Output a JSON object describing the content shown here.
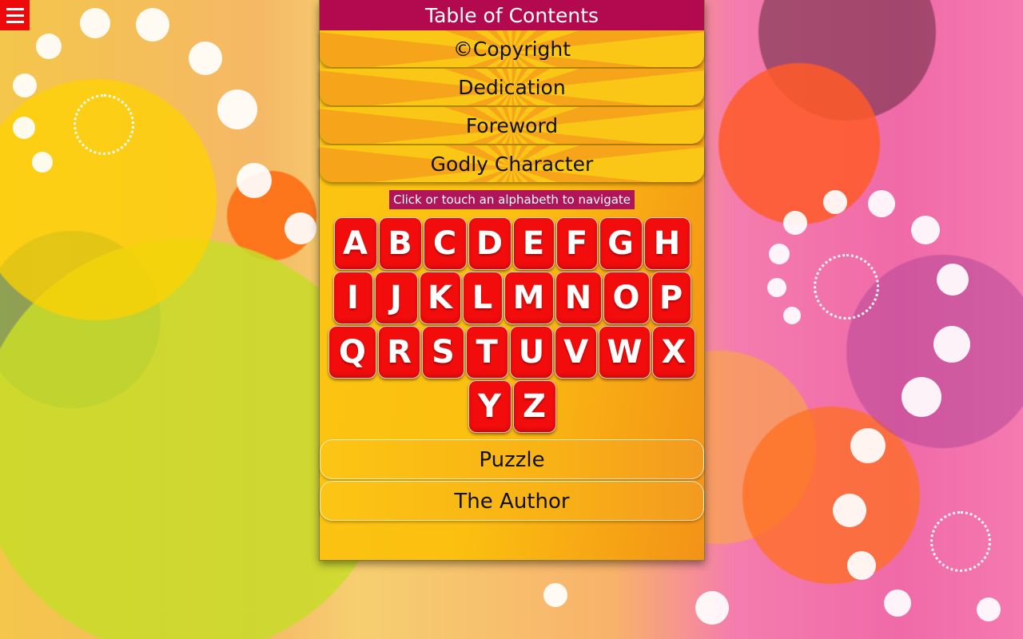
{
  "panel": {
    "title": "Table of Contents",
    "top_items": [
      {
        "label": "©Copyright"
      },
      {
        "label": "Dedication"
      },
      {
        "label": "Foreword"
      },
      {
        "label": "Godly Character"
      }
    ],
    "hint": "Click or touch an alphabeth to navigate",
    "letter_rows": [
      [
        "A",
        "B",
        "C",
        "D",
        "E",
        "F",
        "G",
        "H"
      ],
      [
        "I",
        "J",
        "K",
        "L",
        "M",
        "N",
        "O",
        "P"
      ],
      [
        "Q",
        "R",
        "S",
        "T",
        "U",
        "V",
        "W",
        "X"
      ],
      [
        "Y",
        "Z"
      ]
    ],
    "bottom_items": [
      {
        "label": "Puzzle"
      },
      {
        "label": "The Author"
      }
    ]
  },
  "menu": {
    "icon": "hamburger-menu-icon"
  },
  "colors": {
    "title_bar": "#b30a4f",
    "letter_tile": "#f20c0c",
    "menu_button": "#ee0a0a"
  }
}
